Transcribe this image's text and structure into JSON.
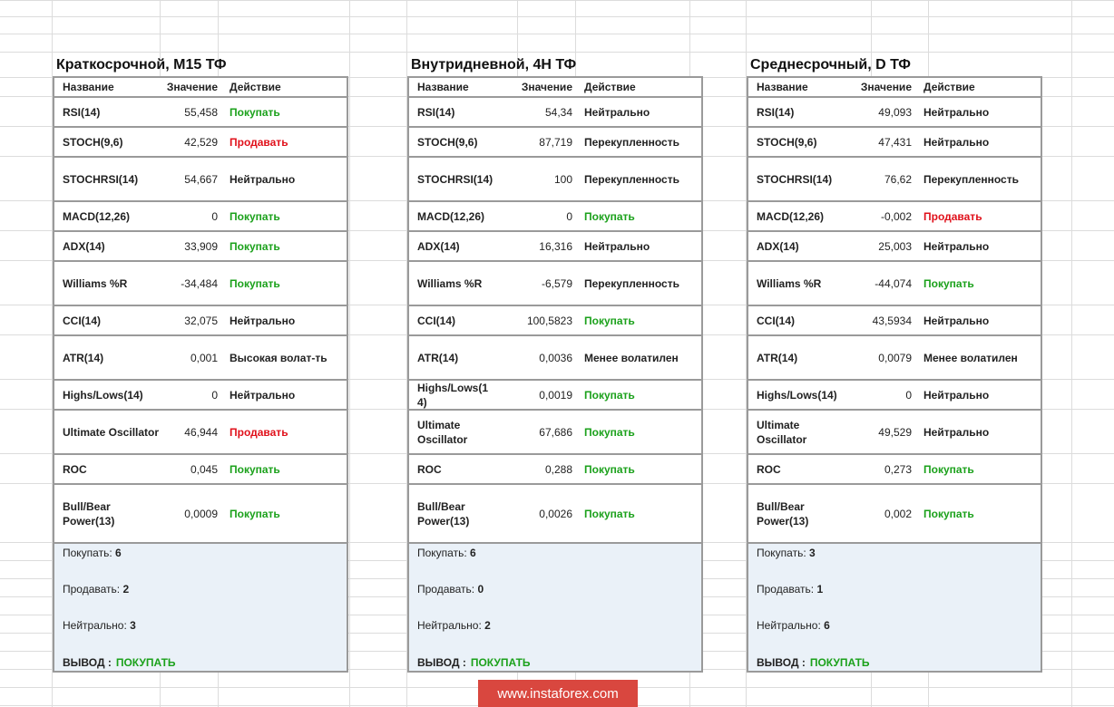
{
  "headers": {
    "name": "Название",
    "value": "Значение",
    "action": "Действие"
  },
  "summary_labels": {
    "buy": "Покупать:",
    "sell": "Продавать:",
    "neutral": "Нейтрально:",
    "verdict": "ВЫВОД :"
  },
  "colors": {
    "buy": "#1ba11b",
    "sell": "#e0111b",
    "summary_bg": "#eaf1f8",
    "watermark_bg": "#d9473f"
  },
  "panels": [
    {
      "title": "Краткосрочной, M15 ТФ",
      "rows": [
        {
          "name": "RSI(14)",
          "value": "55,458",
          "action": "Покупать",
          "type": "buy"
        },
        {
          "name": "STOCH(9,6)",
          "value": "42,529",
          "action": "Продавать",
          "type": "sell"
        },
        {
          "name": "STOCHRSI(14)",
          "value": "54,667",
          "action": "Нейтрально",
          "type": "neutral"
        },
        {
          "name": "MACD(12,26)",
          "value": "0",
          "action": "Покупать",
          "type": "buy"
        },
        {
          "name": "ADX(14)",
          "value": "33,909",
          "action": "Покупать",
          "type": "buy"
        },
        {
          "name": "Williams %R",
          "value": "-34,484",
          "action": "Покупать",
          "type": "buy"
        },
        {
          "name": "CCI(14)",
          "value": "32,075",
          "action": "Нейтрально",
          "type": "neutral"
        },
        {
          "name": "ATR(14)",
          "value": "0,001",
          "action": "Высокая волат-ть",
          "type": "neutral"
        },
        {
          "name": "Highs/Lows(14)",
          "value": "0",
          "action": "Нейтрально",
          "type": "neutral"
        },
        {
          "name": "Ultimate Oscillator",
          "value": "46,944",
          "action": "Продавать",
          "type": "sell"
        },
        {
          "name": "ROC",
          "value": "0,045",
          "action": "Покупать",
          "type": "buy"
        },
        {
          "name": "Bull/Bear\nPower(13)",
          "value": "0,0009",
          "action": "Покупать",
          "type": "buy"
        }
      ],
      "summary": {
        "buy": "6",
        "sell": "2",
        "neutral": "3",
        "verdict": "ПОКУПАТЬ"
      }
    },
    {
      "title": "Внутридневной, 4H ТФ",
      "rows": [
        {
          "name": "RSI(14)",
          "value": "54,34",
          "action": "Нейтрально",
          "type": "neutral"
        },
        {
          "name": "STOCH(9,6)",
          "value": "87,719",
          "action": "Перекупленность",
          "type": "neutral"
        },
        {
          "name": "STOCHRSI(14)",
          "value": "100",
          "action": "Перекупленность",
          "type": "neutral"
        },
        {
          "name": "MACD(12,26)",
          "value": "0",
          "action": "Покупать",
          "type": "buy"
        },
        {
          "name": "ADX(14)",
          "value": "16,316",
          "action": "Нейтрально",
          "type": "neutral"
        },
        {
          "name": "Williams %R",
          "value": "-6,579",
          "action": "Перекупленность",
          "type": "neutral"
        },
        {
          "name": "CCI(14)",
          "value": "100,5823",
          "action": "Покупать",
          "type": "buy"
        },
        {
          "name": "ATR(14)",
          "value": "0,0036",
          "action": "Менее волатилен",
          "type": "neutral"
        },
        {
          "name": "Highs/Lows(1\n4)",
          "value": "0,0019",
          "action": "Покупать",
          "type": "buy"
        },
        {
          "name": "Ultimate\nOscillator",
          "value": "67,686",
          "action": "Покупать",
          "type": "buy"
        },
        {
          "name": "ROC",
          "value": "0,288",
          "action": "Покупать",
          "type": "buy"
        },
        {
          "name": "Bull/Bear\nPower(13)",
          "value": "0,0026",
          "action": "Покупать",
          "type": "buy"
        }
      ],
      "summary": {
        "buy": "6",
        "sell": "0",
        "neutral": "2",
        "verdict": "ПОКУПАТЬ"
      }
    },
    {
      "title": "Среднесрочный, D ТФ",
      "rows": [
        {
          "name": "RSI(14)",
          "value": "49,093",
          "action": "Нейтрально",
          "type": "neutral"
        },
        {
          "name": "STOCH(9,6)",
          "value": "47,431",
          "action": "Нейтрально",
          "type": "neutral"
        },
        {
          "name": "STOCHRSI(14)",
          "value": "76,62",
          "action": "Перекупленность",
          "type": "neutral"
        },
        {
          "name": "MACD(12,26)",
          "value": "-0,002",
          "action": "Продавать",
          "type": "sell"
        },
        {
          "name": "ADX(14)",
          "value": "25,003",
          "action": "Нейтрально",
          "type": "neutral"
        },
        {
          "name": "Williams %R",
          "value": "-44,074",
          "action": "Покупать",
          "type": "buy"
        },
        {
          "name": "CCI(14)",
          "value": "43,5934",
          "action": "Нейтрально",
          "type": "neutral"
        },
        {
          "name": "ATR(14)",
          "value": "0,0079",
          "action": "Менее волатилен",
          "type": "neutral"
        },
        {
          "name": "Highs/Lows(14)",
          "value": "0",
          "action": "Нейтрально",
          "type": "neutral"
        },
        {
          "name": "Ultimate\nOscillator",
          "value": "49,529",
          "action": "Нейтрально",
          "type": "neutral"
        },
        {
          "name": "ROC",
          "value": "0,273",
          "action": "Покупать",
          "type": "buy"
        },
        {
          "name": "Bull/Bear\nPower(13)",
          "value": "0,002",
          "action": "Покупать",
          "type": "buy"
        }
      ],
      "summary": {
        "buy": "3",
        "sell": "1",
        "neutral": "6",
        "verdict": "ПОКУПАТЬ"
      }
    }
  ],
  "watermark": "www.instaforex.com"
}
